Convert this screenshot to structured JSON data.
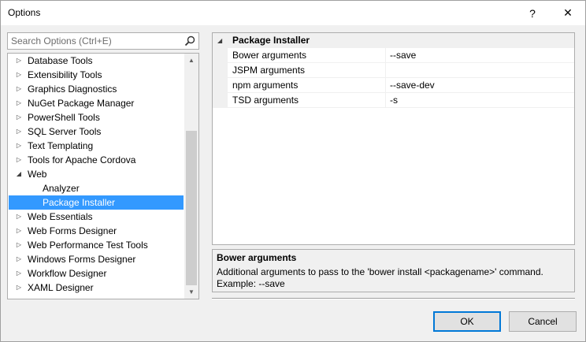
{
  "window": {
    "title": "Options",
    "help_label": "?",
    "close_label": "✕"
  },
  "search": {
    "placeholder": "Search Options (Ctrl+E)"
  },
  "tree": {
    "items": [
      {
        "label": "Database Tools",
        "expander": "▷"
      },
      {
        "label": "Extensibility Tools",
        "expander": "▷"
      },
      {
        "label": "Graphics Diagnostics",
        "expander": "▷"
      },
      {
        "label": "NuGet Package Manager",
        "expander": "▷"
      },
      {
        "label": "PowerShell Tools",
        "expander": "▷"
      },
      {
        "label": "SQL Server Tools",
        "expander": "▷"
      },
      {
        "label": "Text Templating",
        "expander": "▷"
      },
      {
        "label": "Tools for Apache Cordova",
        "expander": "▷"
      },
      {
        "label": "Web",
        "expander": "◢"
      },
      {
        "label": "Analyzer",
        "expander": ""
      },
      {
        "label": "Package Installer",
        "expander": ""
      },
      {
        "label": "Web Essentials",
        "expander": "▷"
      },
      {
        "label": "Web Forms Designer",
        "expander": "▷"
      },
      {
        "label": "Web Performance Test Tools",
        "expander": "▷"
      },
      {
        "label": "Windows Forms Designer",
        "expander": "▷"
      },
      {
        "label": "Workflow Designer",
        "expander": "▷"
      },
      {
        "label": "XAML Designer",
        "expander": "▷"
      }
    ],
    "selected": "Package Installer",
    "scroll_up": "▲",
    "scroll_down": "▼"
  },
  "property_grid": {
    "category": {
      "label": "Package Installer",
      "expander": "◢"
    },
    "rows": [
      {
        "name": "Bower arguments",
        "value": "--save"
      },
      {
        "name": "JSPM arguments",
        "value": ""
      },
      {
        "name": "npm arguments",
        "value": "--save-dev"
      },
      {
        "name": "TSD arguments",
        "value": "-s"
      }
    ]
  },
  "description": {
    "title": "Bower arguments",
    "line1": "Additional arguments to pass to the 'bower install <packagename>' command.",
    "line2": "Example: --save"
  },
  "buttons": {
    "ok": "OK",
    "cancel": "Cancel"
  },
  "colors": {
    "selection": "#3399ff",
    "ok_border": "#0078d7"
  }
}
